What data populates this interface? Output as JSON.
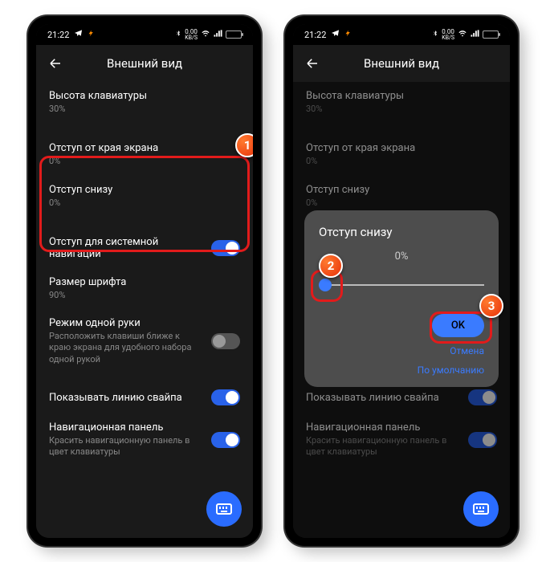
{
  "statusbar": {
    "time": "21:22",
    "net_speed": "0.00",
    "net_unit": "KB/S"
  },
  "header": {
    "title": "Внешний вид"
  },
  "rows": {
    "keyboard_height": {
      "label": "Высота клавиатуры",
      "value": "30%"
    },
    "edge_padding": {
      "label": "Отступ от края экрана",
      "value": "0%"
    },
    "bottom_padding": {
      "label": "Отступ снизу",
      "value": "0%"
    },
    "system_nav_padding": {
      "label": "Отступ для системной навигации"
    },
    "font_size": {
      "label": "Размер шрифта",
      "value": "90%"
    },
    "one_hand": {
      "label": "Режим одной руки",
      "desc": "Расположить клавиши ближе к краю экрана для удобного набора одной рукой"
    },
    "swipe_line": {
      "label": "Показывать линию свайпа"
    },
    "nav_panel": {
      "label": "Навигационная панель",
      "desc": "Красить навигационную панель в цвет клавиатуры"
    }
  },
  "dialog": {
    "title": "Отступ снизу",
    "value": "0%",
    "ok": "OK",
    "cancel": "Отмена",
    "default": "По умолчанию"
  },
  "steps": {
    "s1": "1",
    "s2": "2",
    "s3": "3"
  }
}
